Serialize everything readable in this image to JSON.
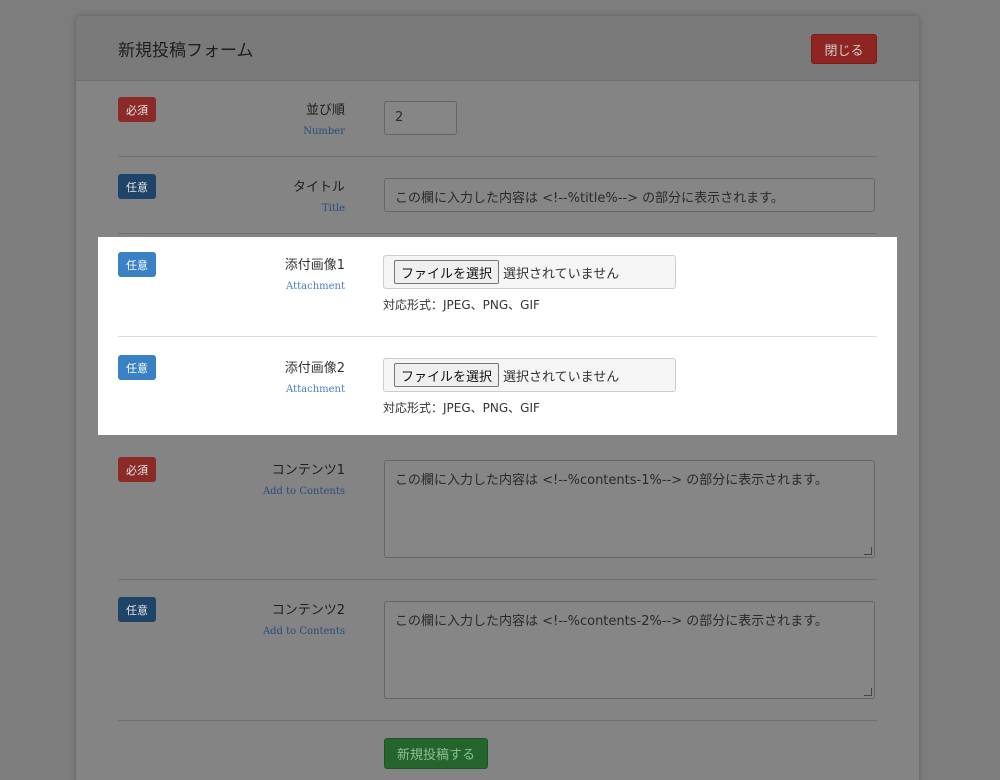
{
  "header": {
    "title": "新規投稿フォーム",
    "close_label": "閉じる"
  },
  "fields": {
    "number": {
      "badge": "必須",
      "label": "並び順",
      "sub": "Number",
      "value": "2"
    },
    "title": {
      "badge": "任意",
      "label": "タイトル",
      "sub": "Title",
      "placeholder": "この欄に入力した内容は <!--%title%--> の部分に表示されます。"
    },
    "attach1": {
      "badge": "任意",
      "label": "添付画像1",
      "sub": "Attachment",
      "button": "ファイルを選択",
      "status": "選択されていません",
      "note": "対応形式：JPEG、PNG、GIF"
    },
    "attach2": {
      "badge": "任意",
      "label": "添付画像2",
      "sub": "Attachment",
      "button": "ファイルを選択",
      "status": "選択されていません",
      "note": "対応形式：JPEG、PNG、GIF"
    },
    "contents1": {
      "badge": "必須",
      "label": "コンテンツ1",
      "sub": "Add to Contents",
      "placeholder": "この欄に入力した内容は <!--%contents-1%--> の部分に表示されます。"
    },
    "contents2": {
      "badge": "任意",
      "label": "コンテンツ2",
      "sub": "Add to Contents",
      "placeholder": "この欄に入力した内容は <!--%contents-2%--> の部分に表示されます。"
    }
  },
  "submit_label": "新規投稿する"
}
